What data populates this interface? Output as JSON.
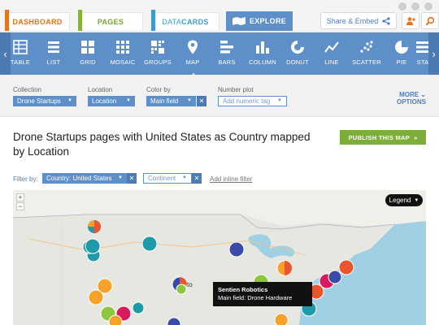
{
  "tabs": {
    "dashboard": "DASHBOARD",
    "pages": "PAGES",
    "datacards_a": "DATA",
    "datacards_b": "CARDS",
    "explore": "EXPLORE"
  },
  "share_label": "Share & Embed",
  "toolbar": [
    {
      "label": "TABLE",
      "icon": "table-icon"
    },
    {
      "label": "LIST",
      "icon": "list-icon"
    },
    {
      "label": "GRID",
      "icon": "grid-icon"
    },
    {
      "label": "MOSAIC",
      "icon": "mosaic-icon"
    },
    {
      "label": "GROUPS",
      "icon": "groups-icon"
    },
    {
      "label": "MAP",
      "icon": "map-pin-icon"
    },
    {
      "label": "BARS",
      "icon": "bars-icon"
    },
    {
      "label": "COLUMN",
      "icon": "column-icon"
    },
    {
      "label": "DONUT",
      "icon": "donut-icon"
    },
    {
      "label": "LINE",
      "icon": "line-icon"
    },
    {
      "label": "SCATTER",
      "icon": "scatter-icon"
    },
    {
      "label": "PIE",
      "icon": "pie-icon"
    },
    {
      "label": "STA",
      "icon": "stack-icon"
    }
  ],
  "controls": {
    "collection_label": "Collection",
    "collection_value": "Drone Startups",
    "location_label": "Location",
    "location_value": "Location",
    "color_label": "Color by",
    "color_value": "Main field",
    "number_label": "Number plot",
    "number_placeholder": "Add numeric tag",
    "more_1": "MORE",
    "more_2": "OPTIONS"
  },
  "heading": "Drone Startups pages with United States as Country mapped by Location",
  "publish_label": "PUBLISH THIS MAP",
  "filter": {
    "label": "Filter by:",
    "country": "Country: United States",
    "continent": "Continent",
    "add_inline": "Add inline filter"
  },
  "map": {
    "legend_label": "Legend",
    "city_label": "to",
    "tooltip_title": "Sentien Robotics",
    "tooltip_detail": "Main field: Drone Hardware"
  },
  "colors": {
    "accent": "#5e8fc8",
    "teal": "#1e9aa8",
    "orange": "#f5a12a",
    "red": "#e8552f",
    "magenta": "#d81b5f",
    "navy": "#3a4aa8",
    "green": "#8cc63f"
  }
}
